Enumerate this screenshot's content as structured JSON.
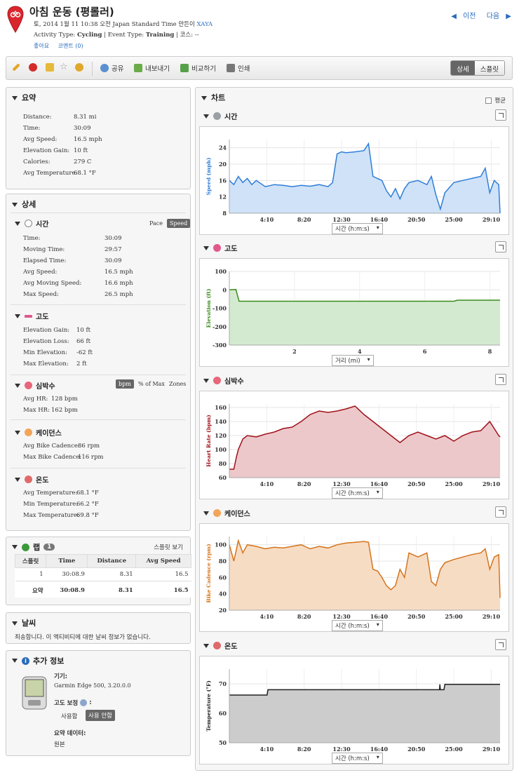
{
  "header": {
    "title": "아침 운동 (평롤러)",
    "meta_date": "토, 2014 1월 11 10:38 오전 Japan Standard Time 만든이",
    "meta_user": "XAYA",
    "meta_activity_prefix": "Activity Type:",
    "activity_type": "Cycling",
    "meta_event_prefix": "| Event Type:",
    "event_type": "Training",
    "meta_course": "| 코스: --",
    "like_label": "좋아요",
    "comment_label": "코멘트 (0)",
    "prev_label": "이전",
    "next_label": "다음"
  },
  "toolbar": {
    "share": "공유",
    "export": "내보내기",
    "compare": "비교하기",
    "print": "인쇄",
    "view_detail": "상세",
    "view_splits": "스플릿"
  },
  "summary": {
    "title": "요약",
    "rows": [
      {
        "label": "Distance:",
        "value": "8.31 mi"
      },
      {
        "label": "Time:",
        "value": "30:09"
      },
      {
        "label": "Avg Speed:",
        "value": "16.5 mph"
      },
      {
        "label": "Elevation Gain:",
        "value": "10 ft"
      },
      {
        "label": "Calories:",
        "value": "279 C"
      },
      {
        "label": "Avg Temperature:",
        "value": "68.1 °F"
      }
    ]
  },
  "details": {
    "title": "상세",
    "time": {
      "title": "시간",
      "pace_label": "Pace",
      "speed_label": "Speed",
      "rows": [
        {
          "label": "Time:",
          "value": "30:09"
        },
        {
          "label": "Moving Time:",
          "value": "29:57"
        },
        {
          "label": "Elapsed Time:",
          "value": "30:09"
        },
        {
          "label": "Avg Speed:",
          "value": "16.5 mph"
        },
        {
          "label": "Avg Moving Speed:",
          "value": "16.6 mph"
        },
        {
          "label": "Max Speed:",
          "value": "26.5 mph"
        }
      ]
    },
    "elevation": {
      "title": "고도",
      "rows": [
        {
          "label": "Elevation Gain:",
          "value": "10 ft"
        },
        {
          "label": "Elevation Loss:",
          "value": "66 ft"
        },
        {
          "label": "Min Elevation:",
          "value": "-62 ft"
        },
        {
          "label": "Max Elevation:",
          "value": "2 ft"
        }
      ]
    },
    "heart": {
      "title": "심박수",
      "bpm_label": "bpm",
      "pct_label": "% of Max",
      "zones_label": "Zones",
      "rows": [
        {
          "label": "Avg HR:",
          "value": "128 bpm"
        },
        {
          "label": "Max HR:",
          "value": "162 bpm"
        }
      ]
    },
    "cadence": {
      "title": "케이던스",
      "rows": [
        {
          "label": "Avg Bike Cadence:",
          "value": "86 rpm"
        },
        {
          "label": "Max Bike Cadence:",
          "value": "116 rpm"
        }
      ]
    },
    "temperature": {
      "title": "온도",
      "rows": [
        {
          "label": "Avg Temperature:",
          "value": "68.1 °F"
        },
        {
          "label": "Min Temperature:",
          "value": "66.2 °F"
        },
        {
          "label": "Max Temperature:",
          "value": "69.8 °F"
        }
      ]
    }
  },
  "laps": {
    "title": "랩",
    "count": "1",
    "splits_link": "스플릿 보기",
    "columns": [
      "스플릿",
      "Time",
      "Distance",
      "Avg Speed"
    ],
    "rows": [
      [
        "1",
        "30:08.9",
        "8.31",
        "16.5"
      ]
    ],
    "total": [
      "요약",
      "30:08.9",
      "8.31",
      "16.5"
    ]
  },
  "weather": {
    "title": "날씨",
    "message": "죄송합니다. 이 액티비티에 대한 날씨 정보가 없습니다."
  },
  "extra": {
    "title": "추가 정보",
    "device_label": "기기:",
    "device_value": "Garmin Edge 500, 3.20.0.0",
    "elev_corr_label": "고도 보정",
    "elev_corr_suffix": ":",
    "use_label": "사용함",
    "nouse_label": "사용 안함",
    "summary_data_label": "요약 데이터:",
    "summary_data_value": "원본"
  },
  "charts_panel": {
    "title": "차트",
    "avg_label": "평균"
  },
  "chart_data": [
    {
      "type": "area",
      "title": "시간",
      "ylabel": "Speed (mph)",
      "xselector": "시간 (h:m:s)",
      "color": "#2f7ed8",
      "fill": "#cfe2f7",
      "x_ticks": [
        "4:10",
        "8:20",
        "12:30",
        "16:40",
        "20:50",
        "25:00",
        "29:10"
      ],
      "x_tick_minutes": [
        4.17,
        8.33,
        12.5,
        16.67,
        20.83,
        25.0,
        29.17
      ],
      "xlim": [
        0,
        30.15
      ],
      "y_ticks": [
        8,
        12,
        16,
        20,
        24
      ],
      "ylim": [
        8,
        26
      ],
      "x": [
        0,
        0.5,
        1,
        1.5,
        2,
        2.5,
        3,
        4,
        5,
        6,
        7,
        8,
        9,
        10,
        11,
        11.5,
        12,
        12.5,
        13,
        14,
        15,
        15.5,
        16,
        16.5,
        17,
        17.5,
        18,
        18.5,
        19,
        19.5,
        20,
        21,
        22,
        22.5,
        23,
        23.5,
        24,
        25,
        26,
        27,
        28,
        28.5,
        29,
        29.5,
        30,
        30.15
      ],
      "y": [
        16,
        15,
        17,
        15.5,
        16.5,
        15,
        16,
        14.5,
        15,
        14.8,
        14.5,
        14.8,
        14.6,
        15,
        14.5,
        15.5,
        22.5,
        23,
        22.8,
        23,
        23.3,
        25,
        17,
        16.5,
        16,
        13.5,
        12,
        14,
        11.5,
        14,
        15.5,
        16,
        15,
        17,
        12.5,
        9,
        13,
        15.5,
        16,
        16.5,
        17,
        19,
        13,
        16,
        15,
        8
      ]
    },
    {
      "type": "area",
      "title": "고도",
      "ylabel": "Elevation (ft)",
      "xselector": "거리 (mi)",
      "color": "#3a8b1e",
      "fill": "#d4ead0",
      "x_ticks": [
        "2",
        "4",
        "6",
        "8"
      ],
      "x_tick_values": [
        2,
        4,
        6,
        8
      ],
      "xlim": [
        0,
        8.31
      ],
      "y_ticks": [
        -300,
        -200,
        -100,
        0,
        100
      ],
      "ylim": [
        -300,
        100
      ],
      "x": [
        0,
        0.2,
        0.3,
        0.4,
        1.5,
        3,
        5,
        6.5,
        6.9,
        7,
        8,
        8.31
      ],
      "y": [
        0,
        2,
        -62,
        -62,
        -62,
        -62,
        -62,
        -62,
        -62,
        -56,
        -56,
        -56
      ]
    },
    {
      "type": "area",
      "title": "심박수",
      "ylabel": "Heart Rate (bpm)",
      "xselector": "시간 (h:m:s)",
      "color": "#a0121a",
      "fill": "#ecc8cb",
      "x_ticks": [
        "4:10",
        "8:20",
        "12:30",
        "16:40",
        "20:50",
        "25:00",
        "29:10"
      ],
      "x_tick_minutes": [
        4.17,
        8.33,
        12.5,
        16.67,
        20.83,
        25.0,
        29.17
      ],
      "xlim": [
        0,
        30.15
      ],
      "y_ticks": [
        60,
        80,
        100,
        120,
        140,
        160
      ],
      "ylim": [
        60,
        165
      ],
      "x": [
        0,
        0.5,
        0.8,
        1,
        1.5,
        2,
        3,
        4,
        5,
        6,
        7,
        8,
        9,
        10,
        11,
        12,
        13,
        14,
        15,
        16,
        17,
        18,
        19,
        20,
        21,
        22,
        23,
        24,
        25,
        26,
        27,
        28,
        29,
        30,
        30.15
      ],
      "y": [
        72,
        72,
        90,
        100,
        115,
        120,
        118,
        122,
        125,
        130,
        132,
        140,
        150,
        155,
        153,
        155,
        158,
        162,
        150,
        140,
        130,
        120,
        110,
        120,
        125,
        120,
        115,
        120,
        112,
        120,
        125,
        127,
        140,
        120,
        118
      ]
    },
    {
      "type": "area",
      "title": "케이던스",
      "ylabel": "Bike Cadence (rpm)",
      "xselector": "시간 (h:m:s)",
      "color": "#d4741c",
      "fill": "#f7dcc4",
      "x_ticks": [
        "4:10",
        "8:20",
        "12:30",
        "16:40",
        "20:50",
        "25:00",
        "29:10"
      ],
      "x_tick_minutes": [
        4.17,
        8.33,
        12.5,
        16.67,
        20.83,
        25.0,
        29.17
      ],
      "xlim": [
        0,
        30.15
      ],
      "y_ticks": [
        20,
        40,
        60,
        80,
        100
      ],
      "ylim": [
        20,
        110
      ],
      "x": [
        0,
        0.5,
        1,
        1.5,
        2,
        3,
        4,
        5,
        6,
        7,
        8,
        9,
        10,
        11,
        12,
        13,
        14,
        15,
        15.5,
        16,
        16.5,
        17,
        17.5,
        18,
        18.5,
        19,
        19.5,
        20,
        21,
        22,
        22.5,
        23,
        23.5,
        24,
        25,
        26,
        27,
        28,
        28.5,
        29,
        29.5,
        30,
        30.15
      ],
      "y": [
        100,
        80,
        105,
        90,
        100,
        98,
        95,
        97,
        96,
        98,
        100,
        95,
        98,
        96,
        100,
        102,
        103,
        104,
        103,
        70,
        68,
        60,
        50,
        45,
        50,
        70,
        60,
        90,
        85,
        90,
        55,
        50,
        70,
        78,
        82,
        85,
        88,
        90,
        95,
        70,
        85,
        88,
        35
      ]
    },
    {
      "type": "area",
      "title": "온도",
      "ylabel": "Temperature (°F)",
      "xselector": "시간 (h:m:s)",
      "color": "#222222",
      "fill": "#cccccc",
      "x_ticks": [
        "4:10",
        "8:20",
        "12:30",
        "16:40",
        "20:50",
        "25:00",
        "29:10"
      ],
      "x_tick_minutes": [
        4.17,
        8.33,
        12.5,
        16.67,
        20.83,
        25.0,
        29.17
      ],
      "xlim": [
        0,
        30.15
      ],
      "y_ticks": [
        50,
        60,
        70
      ],
      "ylim": [
        50,
        75
      ],
      "x": [
        0,
        4.2,
        4.3,
        23.4,
        23.45,
        23.5,
        23.9,
        24,
        30.15
      ],
      "y": [
        66.2,
        66.2,
        68.0,
        68.0,
        69.8,
        68.0,
        68.0,
        69.8,
        69.8
      ]
    }
  ],
  "colors": {
    "accent": "#2a6cbc",
    "selected_toggle": "#666666"
  }
}
